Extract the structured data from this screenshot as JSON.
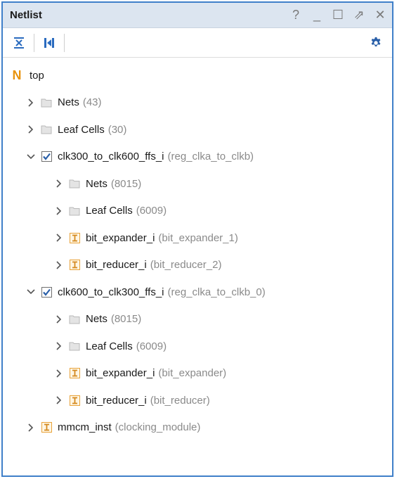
{
  "panel": {
    "title": "Netlist",
    "controls": {
      "help": "?",
      "minimize": "_",
      "maximize": "☐",
      "float": "⇗",
      "close": "✕"
    }
  },
  "toolbar": {
    "collapse_icon": "collapse-all-icon",
    "expand_icon": "expand-all-icon",
    "settings_icon": "gear-icon"
  },
  "colors": {
    "accent": "#3f7fc9",
    "top_icon": "#e8930c",
    "module_icon": "#e8a33a",
    "check": "#2a5fa8"
  },
  "tree": {
    "root": {
      "label": "top"
    },
    "items": [
      {
        "level": 1,
        "expanded": false,
        "icon": "folder",
        "label": "Nets",
        "sub": "(43)"
      },
      {
        "level": 1,
        "expanded": false,
        "icon": "folder",
        "label": "Leaf Cells",
        "sub": "(30)"
      },
      {
        "level": 1,
        "expanded": true,
        "icon": "check",
        "label": "clk300_to_clk600_ffs_i",
        "sub": "(reg_clka_to_clkb)"
      },
      {
        "level": 2,
        "expanded": false,
        "icon": "folder",
        "label": "Nets",
        "sub": "(8015)"
      },
      {
        "level": 2,
        "expanded": false,
        "icon": "folder",
        "label": "Leaf Cells",
        "sub": "(6009)"
      },
      {
        "level": 2,
        "expanded": false,
        "icon": "module",
        "label": "bit_expander_i",
        "sub": "(bit_expander_1)"
      },
      {
        "level": 2,
        "expanded": false,
        "icon": "module",
        "label": "bit_reducer_i",
        "sub": "(bit_reducer_2)"
      },
      {
        "level": 1,
        "expanded": true,
        "icon": "check",
        "label": "clk600_to_clk300_ffs_i",
        "sub": "(reg_clka_to_clkb_0)"
      },
      {
        "level": 2,
        "expanded": false,
        "icon": "folder",
        "label": "Nets",
        "sub": "(8015)"
      },
      {
        "level": 2,
        "expanded": false,
        "icon": "folder",
        "label": "Leaf Cells",
        "sub": "(6009)"
      },
      {
        "level": 2,
        "expanded": false,
        "icon": "module",
        "label": "bit_expander_i",
        "sub": "(bit_expander)"
      },
      {
        "level": 2,
        "expanded": false,
        "icon": "module",
        "label": "bit_reducer_i",
        "sub": "(bit_reducer)"
      },
      {
        "level": 1,
        "expanded": false,
        "icon": "module",
        "label": "mmcm_inst",
        "sub": "(clocking_module)"
      }
    ]
  }
}
